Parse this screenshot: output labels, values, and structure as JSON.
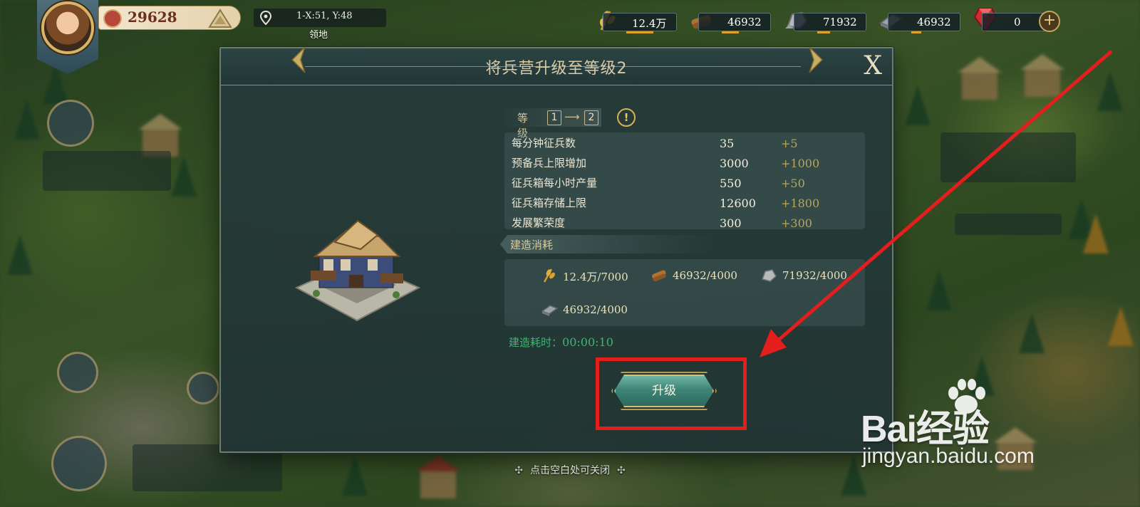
{
  "hud": {
    "power": "29628",
    "coords": "1-X:51, Y:48",
    "territory_label": "领地",
    "resources": [
      {
        "name": "grain",
        "value": "12.4万",
        "fill": 0.55
      },
      {
        "name": "wood",
        "value": "46932",
        "fill": 0.35
      },
      {
        "name": "stone",
        "value": "71932",
        "fill": 0.25
      },
      {
        "name": "iron",
        "value": "46932",
        "fill": 0.2
      },
      {
        "name": "gem",
        "value": "0",
        "fill": 0
      }
    ],
    "plus_label": "+"
  },
  "modal": {
    "title": "将兵营升级至等级2",
    "close_label": "X",
    "level": {
      "label": "等级",
      "from": "1",
      "arrow": "⟶",
      "to": "2",
      "info_icon": "!"
    },
    "stats": [
      {
        "name": "每分钟征兵数",
        "current": "35",
        "increase": "+5"
      },
      {
        "name": "预备兵上限增加",
        "current": "3000",
        "increase": "+1000"
      },
      {
        "name": "征兵箱每小时产量",
        "current": "550",
        "increase": "+50"
      },
      {
        "name": "征兵箱存储上限",
        "current": "12600",
        "increase": "+1800"
      },
      {
        "name": "发展繁荣度",
        "current": "300",
        "increase": "+300"
      }
    ],
    "cost_label": "建造消耗",
    "costs": [
      {
        "icon": "grain-icon",
        "value": "12.4万/7000"
      },
      {
        "icon": "wood-icon",
        "value": "46932/4000"
      },
      {
        "icon": "stone-icon",
        "value": "71932/4000"
      },
      {
        "icon": "iron-icon",
        "value": "46932/4000"
      }
    ],
    "build_time_label": "建造耗时：",
    "build_time_value": "00:00:10",
    "upgrade_label": "升级"
  },
  "footer": {
    "close_hint": "点击空白处可关闭"
  },
  "watermark": {
    "brand": "Bai经验",
    "url": "jingyan.baidu.com"
  },
  "colors": {
    "accent_gold": "#c7a659",
    "time_green": "#3fb472",
    "increase": "#b5a65e",
    "annotation_red": "#e41d1d"
  }
}
